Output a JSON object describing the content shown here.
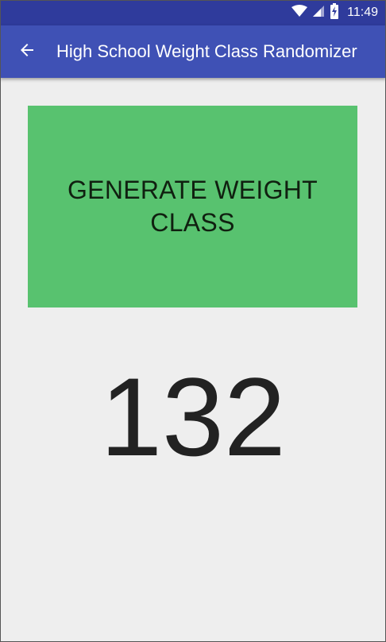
{
  "status_bar": {
    "time": "11:49",
    "icons": [
      "wifi-icon",
      "cellular-signal-icon",
      "battery-charging-icon"
    ]
  },
  "app_bar": {
    "back_icon": "arrow-back-icon",
    "title": "High School Weight Class Randomizer"
  },
  "main": {
    "generate_button_label": "GENERATE WEIGHT CLASS",
    "result_value": "132"
  },
  "colors": {
    "status_bar": "#2f3b9c",
    "app_bar": "#3f51b5",
    "button": "#58c26f",
    "background": "#eeeeee"
  }
}
